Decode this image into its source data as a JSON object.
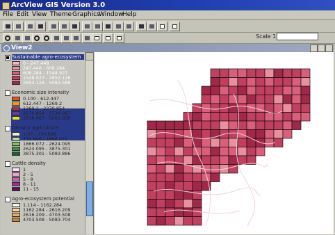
{
  "app": {
    "title": "ArcView GIS Version 3.0"
  },
  "menu": [
    "File",
    "Edit",
    "View",
    "Theme",
    "Graphics",
    "Window",
    "Help"
  ],
  "toolbar": {
    "row1_icons": [
      "save-icon",
      "add-theme-icon",
      "theme-properties-icon",
      "edit-legend-icon",
      "open-table-icon",
      "find-icon",
      "query-builder-icon",
      "zoom-full-icon",
      "zoom-active-icon",
      "zoom-selected-icon",
      "zoom-in-icon",
      "zoom-out-icon",
      "zoom-previous-icon",
      "select-features-icon",
      "clear-select-icon",
      "help-icon"
    ],
    "row2_icons": [
      "info-tool-icon",
      "pointer-tool-icon",
      "vertex-edit-icon",
      "zoom-in-tool-icon",
      "zoom-out-tool-icon",
      "pan-tool-icon",
      "measure-tool-icon",
      "hotlink-tool-icon",
      "label-tool-icon",
      "text-tool-icon",
      "draw-tool-icon",
      "snap-tool-icon"
    ],
    "scale_label": "Scale 1:",
    "scale_value": ""
  },
  "view": {
    "title": "View2"
  },
  "legend": [
    {
      "name": "Sustainable agro-ecosystem",
      "visible": true,
      "active": true,
      "classes": [
        {
          "label": "0 - 247.448",
          "color": "#f0b8c0"
        },
        {
          "label": "247.448 - 608.284",
          "color": "#e8909e"
        },
        {
          "label": "608.284 - 1548.927",
          "color": "#d8607a"
        },
        {
          "label": "1548.927 - 2853.128",
          "color": "#c04060"
        },
        {
          "label": "2853.128 - 5083.568",
          "color": "#a02848"
        }
      ]
    },
    {
      "name": "Economic size intensity",
      "visible": false,
      "active": false,
      "classes": [
        {
          "label": "0.100 - 612.447",
          "color": "#e85020"
        },
        {
          "label": "612.447 - 1269.2",
          "color": "#e8a020"
        },
        {
          "label": "1269.2 - 2270.854",
          "color": "#a03060"
        },
        {
          "label": "2270.854 - 3736.067",
          "color": "#6040a0"
        },
        {
          "label": "3736.067 - 5083.036",
          "color": "#e8e040"
        }
      ]
    },
    {
      "name": "Density agriculture",
      "visible": false,
      "active": false,
      "classes": [
        {
          "label": "1.07 - 730.606",
          "color": "#e8f0d8"
        },
        {
          "label": "730.606 - 1866.072",
          "color": "#b8d8a0"
        },
        {
          "label": "1866.072 - 2624.095",
          "color": "#80c070"
        },
        {
          "label": "2624.095 - 3875.301",
          "color": "#409040"
        },
        {
          "label": "3875.301 - 5083.886",
          "color": "#206030"
        }
      ]
    },
    {
      "name": "Cattle density",
      "visible": false,
      "active": false,
      "classes": [
        {
          "label": "1",
          "color": "#f8e0f0"
        },
        {
          "label": "2 - 5",
          "color": "#e8a0d0"
        },
        {
          "label": "5 - 8",
          "color": "#d060b0"
        },
        {
          "label": "8 - 11",
          "color": "#a03090"
        },
        {
          "label": "11 - 15",
          "color": "#601060"
        }
      ]
    },
    {
      "name": "Agro-ecosystem potential",
      "visible": false,
      "active": false,
      "classes": [
        {
          "label": "1.114 - 1162.284",
          "color": "#fff8e0"
        },
        {
          "label": "1162.284 - 2616.209",
          "color": "#f8d8a0"
        },
        {
          "label": "2616.209 - 4703.508",
          "color": "#e8b060"
        },
        {
          "label": "4703.508 - 5083.704",
          "color": "#d08030"
        }
      ]
    }
  ],
  "colors": {
    "title_bar": "#1a2a8a",
    "active_theme": "#2a3a8a",
    "map_grid_line": "#1a0810",
    "map_bg": "#ffffff"
  }
}
